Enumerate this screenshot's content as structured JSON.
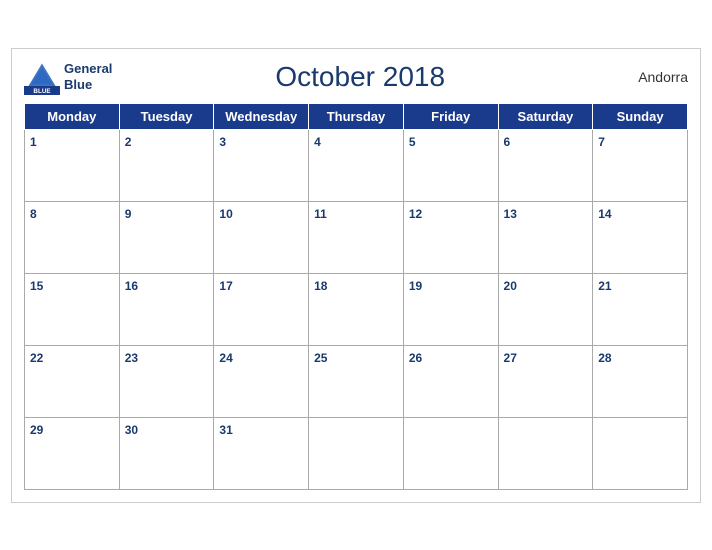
{
  "header": {
    "logo_general": "General",
    "logo_blue": "Blue",
    "title": "October 2018",
    "country": "Andorra"
  },
  "weekdays": [
    "Monday",
    "Tuesday",
    "Wednesday",
    "Thursday",
    "Friday",
    "Saturday",
    "Sunday"
  ],
  "weeks": [
    [
      1,
      2,
      3,
      4,
      5,
      6,
      7
    ],
    [
      8,
      9,
      10,
      11,
      12,
      13,
      14
    ],
    [
      15,
      16,
      17,
      18,
      19,
      20,
      21
    ],
    [
      22,
      23,
      24,
      25,
      26,
      27,
      28
    ],
    [
      29,
      30,
      31,
      null,
      null,
      null,
      null
    ]
  ],
  "colors": {
    "header_bg": "#1a3a8c",
    "header_text": "#ffffff",
    "date_color": "#1a3a6e",
    "row_shade": "#c8d4f0"
  }
}
